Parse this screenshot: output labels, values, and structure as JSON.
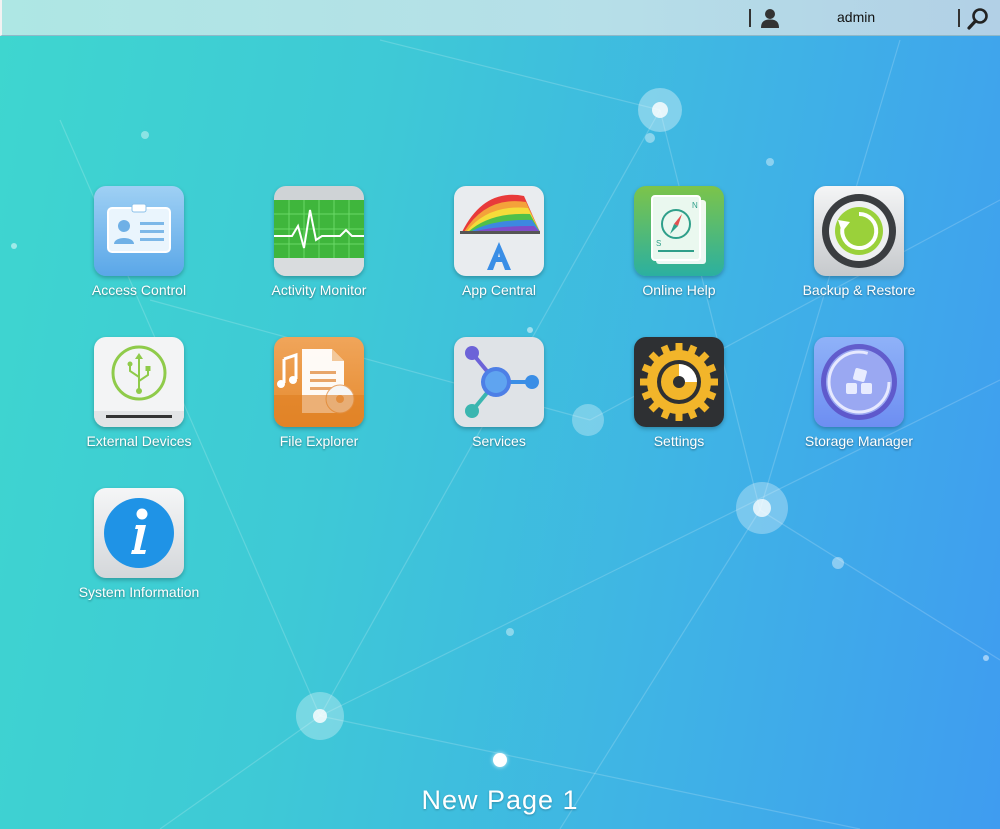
{
  "topbar": {
    "username": "admin",
    "icons": {
      "user": "user-icon",
      "search": "search-icon"
    }
  },
  "apps": [
    {
      "label": "Access Control",
      "icon": "id-card-icon"
    },
    {
      "label": "Activity Monitor",
      "icon": "heartbeat-monitor-icon"
    },
    {
      "label": "App Central",
      "icon": "app-central-icon"
    },
    {
      "label": "Online Help",
      "icon": "compass-book-icon"
    },
    {
      "label": "Backup & Restore",
      "icon": "restore-circle-icon"
    },
    {
      "label": "External Devices",
      "icon": "usb-drive-icon"
    },
    {
      "label": "File Explorer",
      "icon": "file-stack-icon"
    },
    {
      "label": "Services",
      "icon": "network-nodes-icon"
    },
    {
      "label": "Settings",
      "icon": "gear-icon"
    },
    {
      "label": "Storage Manager",
      "icon": "storage-disk-icon"
    },
    {
      "label": "System Information",
      "icon": "info-icon"
    }
  ],
  "pager": {
    "page_name": "New Page 1"
  },
  "colors": {
    "accent": "#3fb2e6",
    "label": "#ffffff"
  }
}
